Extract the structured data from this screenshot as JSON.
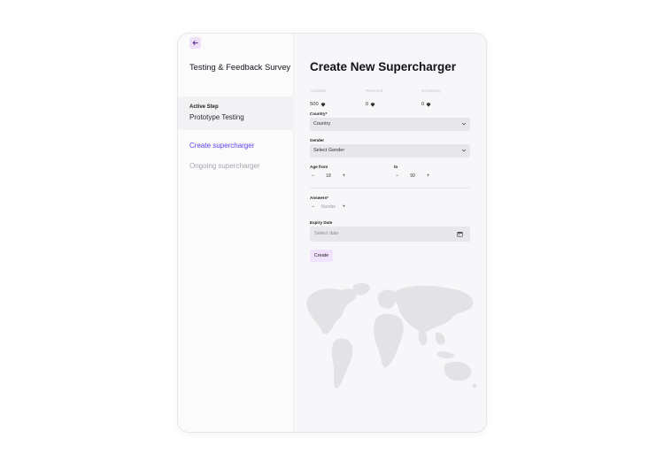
{
  "sidebar": {
    "survey_title": "Testing & Feedback Survey",
    "active_step_label": "Active Step",
    "active_step_value": "Prototype Testing",
    "nav": [
      {
        "label": "Create supercharger"
      },
      {
        "label": "Ongoing supercharger"
      }
    ]
  },
  "main": {
    "title": "Create New Supercharger",
    "stats": [
      {
        "label": "Available",
        "value": "500"
      },
      {
        "label": "Reserved",
        "value": "0"
      },
      {
        "label": "Remaining",
        "value": "0"
      }
    ],
    "country": {
      "label": "Country*",
      "value": "Country"
    },
    "gender": {
      "label": "Gender",
      "value": "Select Gender"
    },
    "age": {
      "from_label": "Age from",
      "to_label": "to",
      "from_value": "18",
      "to_value": "99"
    },
    "answers": {
      "label": "Answers*",
      "placeholder": "Numbe"
    },
    "expiry": {
      "label": "Expiry Date",
      "placeholder": "Select date"
    },
    "create_label": "Create"
  },
  "colors": {
    "accent": "#5b3ff0",
    "button_bg": "#f0e3fb",
    "field_bg": "#e8e8ec",
    "map": "#e3e3e6"
  },
  "icons": [
    "arrow-left-icon",
    "gem-icon",
    "chevron-down-icon",
    "calendar-icon",
    "world-map"
  ]
}
